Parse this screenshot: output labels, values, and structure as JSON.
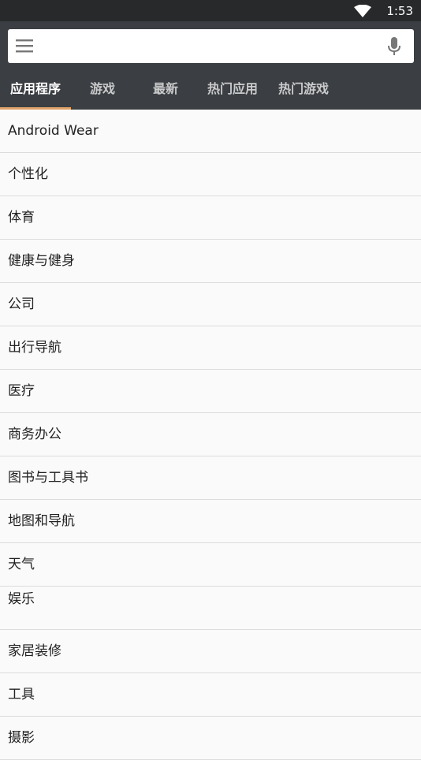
{
  "status_bar": {
    "time": "1:53",
    "icons": [
      "wifi-icon"
    ]
  },
  "search": {
    "value": "",
    "placeholder": "",
    "left_icon": "menu-icon",
    "right_icon": "mic-icon"
  },
  "tabs": [
    {
      "label": "应用程序",
      "active": true
    },
    {
      "label": "游戏",
      "active": false
    },
    {
      "label": "最新",
      "active": false
    },
    {
      "label": "热门应用",
      "active": false
    },
    {
      "label": "热门游戏",
      "active": false
    }
  ],
  "categories": [
    {
      "label": "Android Wear"
    },
    {
      "label": "个性化"
    },
    {
      "label": "体育"
    },
    {
      "label": "健康与健身"
    },
    {
      "label": "公司"
    },
    {
      "label": "出行导航"
    },
    {
      "label": "医疗"
    },
    {
      "label": "商务办公"
    },
    {
      "label": "图书与工具书"
    },
    {
      "label": "地图和导航"
    },
    {
      "label": "天气"
    },
    {
      "label": "娱乐"
    },
    {
      "label": "家居装修"
    },
    {
      "label": "工具"
    },
    {
      "label": "摄影"
    }
  ],
  "colors": {
    "status_bar": "#27292b",
    "top_bar": "#3b3e42",
    "tab_indicator": "#e0a36a",
    "list_background": "#fafafa"
  }
}
